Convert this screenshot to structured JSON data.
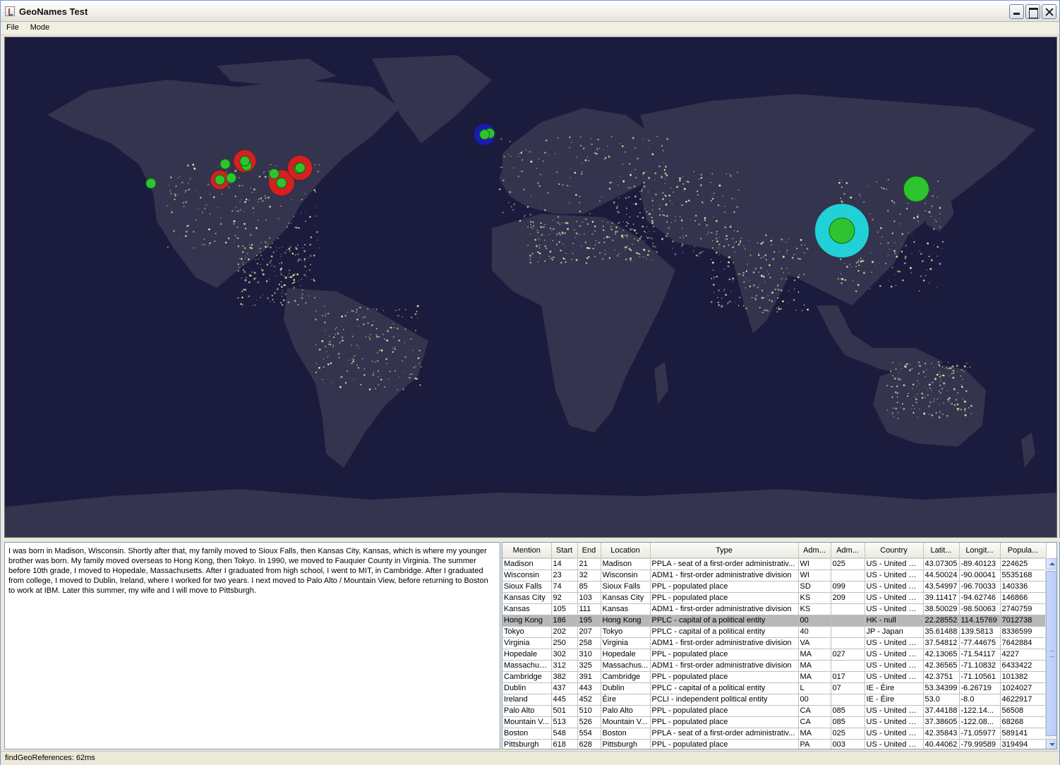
{
  "window": {
    "title": "GeoNames Test"
  },
  "menu": {
    "file": "File",
    "mode": "Mode"
  },
  "document_text": "I was born in Madison, Wisconsin.  Shortly after that, my family moved to Sioux Falls, then Kansas City, Kansas, which is where my younger brother was born.  My family moved overseas to Hong Kong, then Tokyo.  In 1990, we moved to Fauquier County in Virginia.  The summer before 10th grade, I moved to Hopedale, Massachusetts.  After I graduated from high school, I went to MIT, in Cambridge.  After I graduated from college, I moved to Dublin, Ireland, where I worked for two years.  I next moved to Palo Alto / Mountain View, before returning to Boston to work at IBM.  Later this summer, my wife and I will move to Pittsburgh.",
  "table": {
    "columns": [
      "Mention",
      "Start",
      "End",
      "Location",
      "Type",
      "Adm...",
      "Adm...",
      "Country",
      "Latit...",
      "Longit...",
      "Popula..."
    ],
    "selected_row": 5,
    "rows": [
      [
        "Madison",
        "14",
        "21",
        "Madison",
        "PPLA - seat of a first-order administrativ...",
        "WI",
        "025",
        "US - United St...",
        "43.07305",
        "-89.40123",
        "224625"
      ],
      [
        "Wisconsin",
        "23",
        "32",
        "Wisconsin",
        "ADM1 - first-order administrative division",
        "WI",
        "",
        "US - United St...",
        "44.50024",
        "-90.00041",
        "5535168"
      ],
      [
        "Sioux Falls",
        "74",
        "85",
        "Sioux Falls",
        "PPL - populated place",
        "SD",
        "099",
        "US - United St...",
        "43.54997",
        "-96.70033",
        "140336"
      ],
      [
        "Kansas City",
        "92",
        "103",
        "Kansas City",
        "PPL - populated place",
        "KS",
        "209",
        "US - United St...",
        "39.11417",
        "-94.62746",
        "146866"
      ],
      [
        "Kansas",
        "105",
        "111",
        "Kansas",
        "ADM1 - first-order administrative division",
        "KS",
        "",
        "US - United St...",
        "38.50029",
        "-98.50063",
        "2740759"
      ],
      [
        "Hong Kong",
        "186",
        "195",
        "Hong Kong",
        "PPLC - capital of a political entity",
        "00",
        "",
        "HK - null",
        "22.28552",
        "114.15769",
        "7012738"
      ],
      [
        "Tokyo",
        "202",
        "207",
        "Tokyo",
        "PPLC - capital of a political entity",
        "40",
        "",
        "JP - Japan",
        "35.61488",
        "139.5813",
        "8336599"
      ],
      [
        "Virginia",
        "250",
        "258",
        "Virginia",
        "ADM1 - first-order administrative division",
        "VA",
        "",
        "US - United St...",
        "37.54812",
        "-77.44675",
        "7642884"
      ],
      [
        "Hopedale",
        "302",
        "310",
        "Hopedale",
        "PPL - populated place",
        "MA",
        "027",
        "US - United St...",
        "42.13065",
        "-71.54117",
        "4227"
      ],
      [
        "Massachus...",
        "312",
        "325",
        "Massachus...",
        "ADM1 - first-order administrative division",
        "MA",
        "",
        "US - United St...",
        "42.36565",
        "-71.10832",
        "6433422"
      ],
      [
        "Cambridge",
        "382",
        "391",
        "Cambridge",
        "PPL - populated place",
        "MA",
        "017",
        "US - United St...",
        "42.3751",
        "-71.10561",
        "101382"
      ],
      [
        "Dublin",
        "437",
        "443",
        "Dublin",
        "PPLC - capital of a political entity",
        "L",
        "07",
        "IE - Éire",
        "53.34399",
        "-6.26719",
        "1024027"
      ],
      [
        "Ireland",
        "445",
        "452",
        "Éire",
        "PCLI - independent political entity",
        "00",
        "",
        "IE - Éire",
        "53.0",
        "-8.0",
        "4622917"
      ],
      [
        "Palo Alto",
        "501",
        "510",
        "Palo Alto",
        "PPL - populated place",
        "CA",
        "085",
        "US - United St...",
        "37.44188",
        "-122.14...",
        "56508"
      ],
      [
        "Mountain V...",
        "513",
        "526",
        "Mountain V...",
        "PPL - populated place",
        "CA",
        "085",
        "US - United St...",
        "37.38605",
        "-122.08...",
        "68268"
      ],
      [
        "Boston",
        "548",
        "554",
        "Boston",
        "PPLA - seat of a first-order administrativ...",
        "MA",
        "025",
        "US - United St...",
        "42.35843",
        "-71.05977",
        "589141"
      ],
      [
        "Pittsburgh",
        "618",
        "628",
        "Pittsburgh",
        "PPL - populated place",
        "PA",
        "003",
        "US - United St...",
        "40.44062",
        "-79.99589",
        "319494"
      ]
    ]
  },
  "map": {
    "ocean_color": "#1b1b3d",
    "land_color": "#34344f",
    "lights_color": "#f6f2a8",
    "markers": [
      {
        "name": "Madison",
        "lat": 43.07305,
        "lon": -89.40123,
        "ring": "none",
        "ring_scale": 0
      },
      {
        "name": "Wisconsin",
        "lat": 44.50024,
        "lon": -90.00041,
        "ring": "#d42020",
        "ring_scale": 1.0
      },
      {
        "name": "Sioux Falls",
        "lat": 43.54997,
        "lon": -96.70033,
        "ring": "none",
        "ring_scale": 0
      },
      {
        "name": "Kansas City",
        "lat": 39.11417,
        "lon": -94.62746,
        "ring": "none",
        "ring_scale": 0
      },
      {
        "name": "Kansas",
        "lat": 38.50029,
        "lon": -98.50063,
        "ring": "#d42020",
        "ring_scale": 0.85
      },
      {
        "name": "Hong Kong",
        "lat": 22.28552,
        "lon": 114.15769,
        "ring": "#22d0d8",
        "ring_scale": 2.4
      },
      {
        "name": "Tokyo",
        "lat": 35.61488,
        "lon": 139.5813,
        "ring": "none",
        "ring_scale": 0
      },
      {
        "name": "Virginia",
        "lat": 37.54812,
        "lon": -77.44675,
        "ring": "#d42020",
        "ring_scale": 1.15
      },
      {
        "name": "Hopedale",
        "lat": 42.13065,
        "lon": -71.54117,
        "ring": "none",
        "ring_scale": 0
      },
      {
        "name": "Massachusetts",
        "lat": 42.36565,
        "lon": -71.10832,
        "ring": "#d42020",
        "ring_scale": 1.1
      },
      {
        "name": "Cambridge",
        "lat": 42.3751,
        "lon": -71.10561,
        "ring": "none",
        "ring_scale": 0
      },
      {
        "name": "Dublin",
        "lat": 53.34399,
        "lon": -6.26719,
        "ring": "none",
        "ring_scale": 0
      },
      {
        "name": "Ireland",
        "lat": 53.0,
        "lon": -8.0,
        "ring": "#1a1ab5",
        "ring_scale": 0.95
      },
      {
        "name": "Palo Alto",
        "lat": 37.44188,
        "lon": -122.14,
        "ring": "none",
        "ring_scale": 0
      },
      {
        "name": "Mountain View",
        "lat": 37.38605,
        "lon": -122.08,
        "ring": "none",
        "ring_scale": 0
      },
      {
        "name": "Boston",
        "lat": 42.35843,
        "lon": -71.05977,
        "ring": "none",
        "ring_scale": 0
      },
      {
        "name": "Pittsburgh",
        "lat": 40.44062,
        "lon": -79.99589,
        "ring": "none",
        "ring_scale": 0
      }
    ],
    "marker_fill": "#2fc42f",
    "marker_stroke": "#0f6a0f"
  },
  "status": {
    "text": "findGeoReferences: 62ms"
  }
}
